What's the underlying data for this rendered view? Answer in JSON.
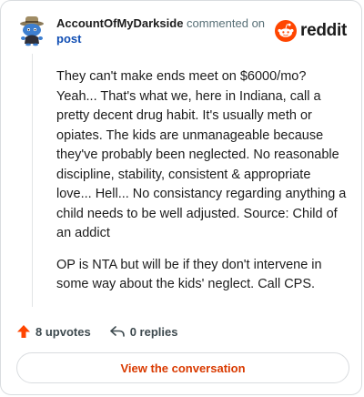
{
  "header": {
    "username": "AccountOfMyDarkside",
    "action_text": " commented on ",
    "target_text": "post",
    "brand_name": "reddit"
  },
  "comment": {
    "paragraphs": [
      "They can't make ends meet on $6000/mo? Yeah... That's what we, here in Indiana, call a pretty decent drug habit. It's usually meth or opiates. The kids are unmanageable because they've probably been neglected. No reasonable discipline, stability, consistent & appropriate love... Hell... No consistancy regarding anything a child needs to be well adjusted. Source: Child of an addict",
      "OP is NTA but will be if they don't intervene in some way about the kids' neglect. Call CPS."
    ]
  },
  "actions": {
    "upvotes_label": "8 upvotes",
    "replies_label": "0 replies"
  },
  "cta": {
    "label": "View the conversation"
  },
  "colors": {
    "brand_orange": "#ff4500",
    "link_blue": "#0f4db3",
    "cta_text": "#d93a00",
    "muted_text": "#576f76"
  },
  "icons": {
    "avatar": "snoo-avatar-with-hat",
    "brand": "reddit-snoo-logo",
    "upvote": "upvote-arrow-icon",
    "reply": "reply-arrow-icon"
  }
}
